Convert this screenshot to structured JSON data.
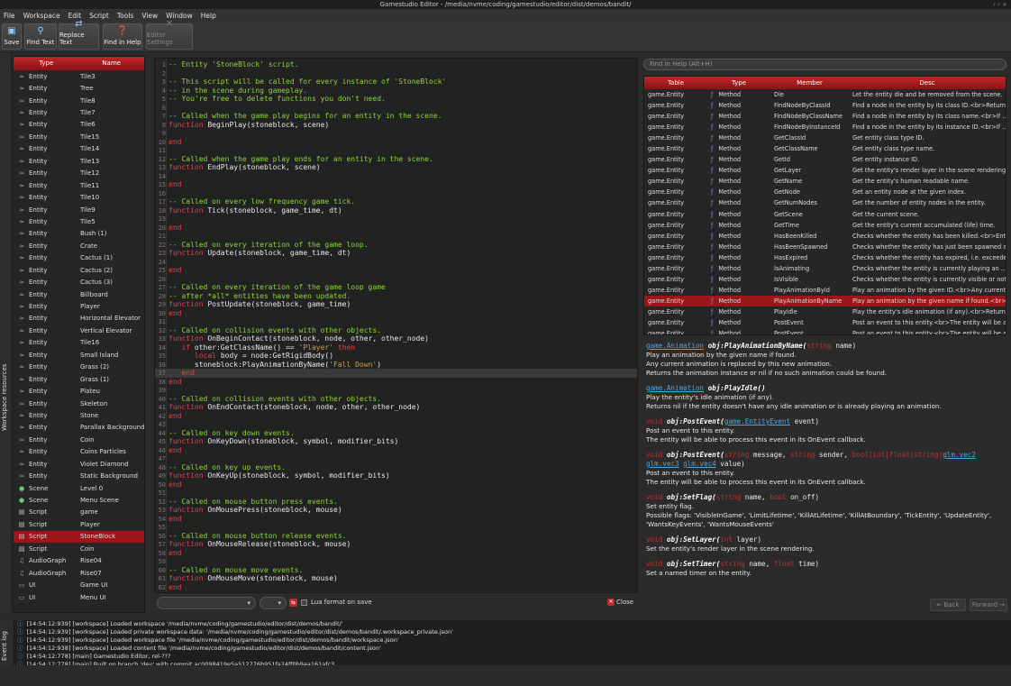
{
  "window": {
    "title": "Gamestudio Editor - /media/nvme/coding/gamestudio/editor/dist/demos/bandit/"
  },
  "menu": [
    "File",
    "Workspace",
    "Edit",
    "Script",
    "Tools",
    "View",
    "Window",
    "Help"
  ],
  "toolbar": {
    "save": "Save",
    "find_text": "Find Text",
    "replace_text": "Replace Text",
    "find_in_help": "Find in Help",
    "editor_settings": "Editor Settings"
  },
  "sidebar": {
    "tab_label": "Workspace resources"
  },
  "resources": {
    "headers": {
      "type": "Type",
      "name": "Name"
    },
    "rows": [
      {
        "type": "Entity",
        "name": "Tile3",
        "icon": "entity-icon"
      },
      {
        "type": "Entity",
        "name": "Tree",
        "icon": "entity-icon"
      },
      {
        "type": "Entity",
        "name": "Tile8",
        "icon": "entity-icon"
      },
      {
        "type": "Entity",
        "name": "Tile7",
        "icon": "entity-icon"
      },
      {
        "type": "Entity",
        "name": "Tile6",
        "icon": "entity-icon"
      },
      {
        "type": "Entity",
        "name": "Tile15",
        "icon": "entity-icon"
      },
      {
        "type": "Entity",
        "name": "Tile14",
        "icon": "entity-icon"
      },
      {
        "type": "Entity",
        "name": "Tile13",
        "icon": "entity-icon"
      },
      {
        "type": "Entity",
        "name": "Tile12",
        "icon": "entity-icon"
      },
      {
        "type": "Entity",
        "name": "Tile11",
        "icon": "entity-icon"
      },
      {
        "type": "Entity",
        "name": "Tile10",
        "icon": "entity-icon"
      },
      {
        "type": "Entity",
        "name": "Tile9",
        "icon": "entity-icon"
      },
      {
        "type": "Entity",
        "name": "Tile5",
        "icon": "entity-icon"
      },
      {
        "type": "Entity",
        "name": "Bush (1)",
        "icon": "entity-icon"
      },
      {
        "type": "Entity",
        "name": "Crate",
        "icon": "entity-icon"
      },
      {
        "type": "Entity",
        "name": "Cactus (1)",
        "icon": "entity-icon"
      },
      {
        "type": "Entity",
        "name": "Cactus (2)",
        "icon": "entity-icon"
      },
      {
        "type": "Entity",
        "name": "Cactus (3)",
        "icon": "entity-icon"
      },
      {
        "type": "Entity",
        "name": "Billboard",
        "icon": "entity-icon"
      },
      {
        "type": "Entity",
        "name": "Player",
        "icon": "entity-icon"
      },
      {
        "type": "Entity",
        "name": "Horizontal Elevator",
        "icon": "entity-icon"
      },
      {
        "type": "Entity",
        "name": "Vertical Elevator",
        "icon": "entity-icon"
      },
      {
        "type": "Entity",
        "name": "Tile16",
        "icon": "entity-icon"
      },
      {
        "type": "Entity",
        "name": "Small Island",
        "icon": "entity-icon"
      },
      {
        "type": "Entity",
        "name": "Grass (2)",
        "icon": "entity-icon"
      },
      {
        "type": "Entity",
        "name": "Grass (1)",
        "icon": "entity-icon"
      },
      {
        "type": "Entity",
        "name": "Plateu",
        "icon": "entity-icon"
      },
      {
        "type": "Entity",
        "name": "Skeleton",
        "icon": "entity-icon"
      },
      {
        "type": "Entity",
        "name": "Stone",
        "icon": "entity-icon"
      },
      {
        "type": "Entity",
        "name": "Parallax Background",
        "icon": "entity-icon"
      },
      {
        "type": "Entity",
        "name": "Coin",
        "icon": "entity-icon"
      },
      {
        "type": "Entity",
        "name": "Coins Particles",
        "icon": "entity-icon"
      },
      {
        "type": "Entity",
        "name": "Violet Diamond",
        "icon": "entity-icon"
      },
      {
        "type": "Entity",
        "name": "Static Background",
        "icon": "entity-icon"
      },
      {
        "type": "Scene",
        "name": "Level 0",
        "icon": "scene-icon"
      },
      {
        "type": "Scene",
        "name": "Menu Scene",
        "icon": "scene-icon"
      },
      {
        "type": "Script",
        "name": "game",
        "icon": "script-icon"
      },
      {
        "type": "Script",
        "name": "Player",
        "icon": "script-icon"
      },
      {
        "type": "Script",
        "name": "StoneBlock",
        "icon": "script-icon",
        "selected": true
      },
      {
        "type": "Script",
        "name": "Coin",
        "icon": "script-icon"
      },
      {
        "type": "AudioGraph",
        "name": "Rise04",
        "icon": "audio-icon"
      },
      {
        "type": "AudioGraph",
        "name": "Rise07",
        "icon": "audio-icon"
      },
      {
        "type": "UI",
        "name": "Game UI",
        "icon": "ui-icon"
      },
      {
        "type": "UI",
        "name": "Menu UI",
        "icon": "ui-icon"
      }
    ]
  },
  "editor": {
    "lines": [
      [
        [
          "cm",
          "-- Entity 'StoneBlock' script."
        ]
      ],
      [],
      [
        [
          "cm",
          "-- This script will be called for every instance of 'StoneBlock'"
        ]
      ],
      [
        [
          "cm",
          "-- in the scene during gameplay."
        ]
      ],
      [
        [
          "cm",
          "-- You're free to delete functions you don't need."
        ]
      ],
      [],
      [
        [
          "cm",
          "-- Called when the game play begins for an entity in the scene."
        ]
      ],
      [
        [
          "kw",
          "function "
        ],
        [
          "tx",
          "BeginPlay(stoneblock, scene)"
        ]
      ],
      [],
      [
        [
          "kw",
          "end"
        ]
      ],
      [],
      [
        [
          "cm",
          "-- Called when the game play ends for an entity in the scene."
        ]
      ],
      [
        [
          "kw",
          "function "
        ],
        [
          "tx",
          "EndPlay(stoneblock, scene)"
        ]
      ],
      [],
      [
        [
          "kw",
          "end"
        ]
      ],
      [],
      [
        [
          "cm",
          "-- Called on every low frequency game tick."
        ]
      ],
      [
        [
          "kw",
          "function "
        ],
        [
          "tx",
          "Tick(stoneblock, game_time, dt)"
        ]
      ],
      [],
      [
        [
          "kw",
          "end"
        ]
      ],
      [],
      [
        [
          "cm",
          "-- Called on every iteration of the game loop."
        ]
      ],
      [
        [
          "kw",
          "function "
        ],
        [
          "tx",
          "Update(stoneblock, game_time, dt)"
        ]
      ],
      [],
      [
        [
          "kw",
          "end"
        ]
      ],
      [],
      [
        [
          "cm",
          "-- Called on every iteration of the game loop game"
        ]
      ],
      [
        [
          "cm",
          "-- after *all* entities have been updated."
        ]
      ],
      [
        [
          "kw",
          "function "
        ],
        [
          "tx",
          "PostUpdate(stoneblock, game_time)"
        ]
      ],
      [
        [
          "kw",
          "end"
        ]
      ],
      [],
      [
        [
          "cm",
          "-- Called on collision events with other objects."
        ]
      ],
      [
        [
          "kw",
          "function "
        ],
        [
          "tx",
          "OnBeginContact(stoneblock, node, other, other_node)"
        ]
      ],
      [
        [
          "tx",
          "   "
        ],
        [
          "kw",
          "if "
        ],
        [
          "tx",
          "other:GetClassName() == "
        ],
        [
          "st",
          "'Player'"
        ],
        [
          "kw",
          " then"
        ]
      ],
      [
        [
          "tx",
          "      "
        ],
        [
          "kw",
          "local "
        ],
        [
          "tx",
          "body = node:GetRigidBody()"
        ]
      ],
      [
        [
          "tx",
          "      stoneblock:PlayAnimationByName("
        ],
        [
          "st",
          "'Fall Down'"
        ],
        [
          "tx",
          ")"
        ]
      ],
      [
        [
          "tx",
          "   "
        ],
        [
          "kw",
          "end"
        ]
      ],
      [
        [
          "kw",
          "end"
        ]
      ],
      [],
      [
        [
          "cm",
          "-- Called on collision events with other objects."
        ]
      ],
      [
        [
          "kw",
          "function "
        ],
        [
          "tx",
          "OnEndContact(stoneblock, node, other, other_node)"
        ]
      ],
      [
        [
          "kw",
          "end"
        ]
      ],
      [],
      [
        [
          "cm",
          "-- Called on key down events."
        ]
      ],
      [
        [
          "kw",
          "function "
        ],
        [
          "tx",
          "OnKeyDown(stoneblock, symbol, modifier_bits)"
        ]
      ],
      [
        [
          "kw",
          "end"
        ]
      ],
      [],
      [
        [
          "cm",
          "-- Called on key up events."
        ]
      ],
      [
        [
          "kw",
          "function "
        ],
        [
          "tx",
          "OnKeyUp(stoneblock, symbol, modifier_bits)"
        ]
      ],
      [
        [
          "kw",
          "end"
        ]
      ],
      [],
      [
        [
          "cm",
          "-- Called on mouse button press events."
        ]
      ],
      [
        [
          "kw",
          "function "
        ],
        [
          "tx",
          "OnMousePress(stoneblock, mouse)"
        ]
      ],
      [
        [
          "kw",
          "end"
        ]
      ],
      [],
      [
        [
          "cm",
          "-- Called on mouse button release events."
        ]
      ],
      [
        [
          "kw",
          "function "
        ],
        [
          "tx",
          "OnMouseRelease(stoneblock, mouse)"
        ]
      ],
      [
        [
          "kw",
          "end"
        ]
      ],
      [],
      [
        [
          "cm",
          "-- Called on mouse move events."
        ]
      ],
      [
        [
          "kw",
          "function "
        ],
        [
          "tx",
          "OnMouseMove(stoneblock, mouse)"
        ]
      ],
      [
        [
          "kw",
          "end"
        ]
      ]
    ],
    "line_numbers": [
      "1",
      "2",
      "3",
      "4",
      "5",
      "6",
      "7",
      "8",
      "9",
      "10",
      "11",
      "12",
      "13",
      "14",
      "15",
      "16",
      "17",
      "18",
      "19",
      "20",
      "21",
      "22",
      "23",
      "24",
      "25",
      "26",
      "27",
      "28",
      "29",
      "30",
      "31",
      "32",
      "33",
      "34",
      "35",
      "36",
      "37",
      "38",
      "39",
      "40",
      "41",
      "42",
      "43",
      "44",
      "45",
      "46",
      "47",
      "48",
      "49",
      "50",
      "51",
      "52",
      "53",
      "54",
      "55",
      "56",
      "57",
      "58",
      "59",
      "60",
      "61",
      "62"
    ],
    "current_line": 37,
    "lua_format_label": "Lua format on save",
    "close_label": "Close"
  },
  "help": {
    "search_placeholder": "Find in Help (Alt+H)",
    "table_headers": {
      "table": "Table",
      "type": "Type",
      "member": "Member",
      "desc": "Desc"
    },
    "rows": [
      {
        "table": "game.Entity",
        "type": "Method",
        "member": "Die",
        "desc": "Let the entity die and be removed from the scene."
      },
      {
        "table": "game.Entity",
        "type": "Method",
        "member": "FindNodeByClassId",
        "desc": "Find a node in the entity by its class ID.<br>Returns ..."
      },
      {
        "table": "game.Entity",
        "type": "Method",
        "member": "FindNodeByClassName",
        "desc": "Find a node in the entity by its class name.<br>If ..."
      },
      {
        "table": "game.Entity",
        "type": "Method",
        "member": "FindNodeByInstanceId",
        "desc": "Find a node in the entity by its instance ID.<br>If ..."
      },
      {
        "table": "game.Entity",
        "type": "Method",
        "member": "GetClassId",
        "desc": "Get entity class type ID."
      },
      {
        "table": "game.Entity",
        "type": "Method",
        "member": "GetClassName",
        "desc": "Get entity class type name."
      },
      {
        "table": "game.Entity",
        "type": "Method",
        "member": "GetId",
        "desc": "Get entity instance ID."
      },
      {
        "table": "game.Entity",
        "type": "Method",
        "member": "GetLayer",
        "desc": "Get the entity's render layer in the scene rendering."
      },
      {
        "table": "game.Entity",
        "type": "Method",
        "member": "GetName",
        "desc": "Get the entity's human readable name."
      },
      {
        "table": "game.Entity",
        "type": "Method",
        "member": "GetNode",
        "desc": "Get an entity node at the given index."
      },
      {
        "table": "game.Entity",
        "type": "Method",
        "member": "GetNumNodes",
        "desc": "Get the number of entity nodes in the entity."
      },
      {
        "table": "game.Entity",
        "type": "Method",
        "member": "GetScene",
        "desc": "Get the current scene."
      },
      {
        "table": "game.Entity",
        "type": "Method",
        "member": "GetTime",
        "desc": "Get the entity's current accumulated (life) time."
      },
      {
        "table": "game.Entity",
        "type": "Method",
        "member": "HasBeenKilled",
        "desc": "Checks whether the entity has been killed.<br>Entiti..."
      },
      {
        "table": "game.Entity",
        "type": "Method",
        "member": "HasBeenSpawned",
        "desc": "Checks whether the entity has just been spawned a..."
      },
      {
        "table": "game.Entity",
        "type": "Method",
        "member": "HasExpired",
        "desc": "Checks whether the entity has expired, i.e. exceeded..."
      },
      {
        "table": "game.Entity",
        "type": "Method",
        "member": "IsAnimating",
        "desc": "Checks whether the entity is currently playing an ..."
      },
      {
        "table": "game.Entity",
        "type": "Method",
        "member": "IsVisible",
        "desc": "Checks whether the entity is currently visible or not."
      },
      {
        "table": "game.Entity",
        "type": "Method",
        "member": "PlayAnimationById",
        "desc": "Play an animation by the given ID.<br>Any current ..."
      },
      {
        "table": "game.Entity",
        "type": "Method",
        "member": "PlayAnimationByName",
        "desc": "Play an animation by the given name if found.<br>A...",
        "selected": true
      },
      {
        "table": "game.Entity",
        "type": "Method",
        "member": "PlayIdle",
        "desc": "Play the entity's idle animation (if any).<br>Returns ..."
      },
      {
        "table": "game.Entity",
        "type": "Method",
        "member": "PostEvent",
        "desc": "Post an event to this entity.<br>The entity will be abl..."
      },
      {
        "table": "game.Entity",
        "type": "Method",
        "member": "PostEvent",
        "desc": "Post an event to this entity.<br>The entity will be abl..."
      }
    ],
    "docs": {
      "d1_ret": "game.Animation",
      "d1_fn": "obj:PlayAnimationByName(",
      "d1_argtype": "string",
      "d1_arg": " name)",
      "d1_l1": "Play an animation by the given name if found.",
      "d1_l2": "Any current animation is replaced by this new animation.",
      "d1_l3": "Returns the animation instance or nil if no such animation could be found.",
      "d2_ret": "game.Animation",
      "d2_fn": "obj:PlayIdle()",
      "d2_l1": "Play the entity's idle animation (if any).",
      "d2_l2": "Returns nil if the entity doesn't have any idle animation or is already playing an animation.",
      "d3_ret": "void",
      "d3_fn": "obj:PostEvent(",
      "d3_argtype": "game.EntityEvent",
      "d3_arg": " event)",
      "d3_l1": "Post an event to this entity.",
      "d3_l2": "The entity will be able to process this event in its OnEvent callback.",
      "d4_ret": "void",
      "d4_fn": "obj:PostEvent(",
      "d4_t1": "string",
      "d4_a1": " message, ",
      "d4_t2": "string",
      "d4_a2": " sender, ",
      "d4_t3": "bool|int|float|string|",
      "d4_t4": "glm.vec2",
      "d4_t5": "glm.vec3",
      "d4_t6": "glm.vec4",
      "d4_a3": " value)",
      "d4_l1": "Post an event to this entity.",
      "d4_l2": "The entity will be able to process this event in its OnEvent callback.",
      "d5_ret": "void",
      "d5_fn": "obj:SetFlag(",
      "d5_t1": "string",
      "d5_a1": " name, ",
      "d5_t2": "bool",
      "d5_a2": " on_off)",
      "d5_l1": "Set entity flag.",
      "d5_l2": "Possible flags: 'VisibleInGame', 'LimitLifetime', 'KillAtLifetime', 'KillAtBoundary', 'TickEntity', 'UpdateEntity',",
      "d5_l3": "'WantsKeyEvents', 'WantsMouseEvents'",
      "d6_ret": "void",
      "d6_fn": "obj:SetLayer(",
      "d6_t1": "int",
      "d6_a1": " layer)",
      "d6_l1": "Set the entity's render layer in the scene rendering.",
      "d7_ret": "void",
      "d7_fn": "obj:SetTimer(",
      "d7_t1": "string",
      "d7_a1": " name, ",
      "d7_t2": "float",
      "d7_a2": " time)",
      "d7_l1": "Set a named timer on the entity."
    },
    "back": "Back",
    "forward": "Forward"
  },
  "log": {
    "tab_label": "Event log",
    "lines": [
      "[14:54:12:939] [workspace] Loaded workspace '/media/nvme/coding/gamestudio/editor/dist/demos/bandit/'",
      "[14:54:12:939] [workspace] Loaded private workspace data: '/media/nvme/coding/gamestudio/editor/dist/demos/bandit/.workspace_private.json'",
      "[14:54:12:939] [workspace] Loaded workspace file '/media/nvme/coding/gamestudio/editor/dist/demos/bandit/workspace.json'",
      "[14:54:12:938] [workspace] Loaded content file '/media/nvme/coding/gamestudio/editor/dist/demos/bandit/content.json'",
      "[14:54:12:778] [main] Gamestudio Editor, rel-???",
      "[14:54:12:778] [main] Built on branch 'dev' with commit ac0098419e5a512776b951fa24ff0b9aa161afc3"
    ]
  },
  "colors": {
    "accent": "#9c1518",
    "comment": "#8bd53a",
    "keyword": "#e0404a",
    "link": "#4aa8e0"
  }
}
